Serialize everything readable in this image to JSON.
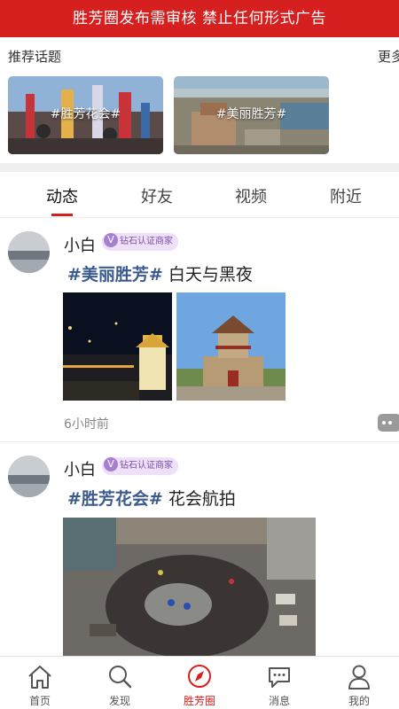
{
  "notice": "胜芳圈发布需审核 禁止任何形式广告",
  "topics": {
    "title": "推荐话题",
    "more": "更多",
    "cards": [
      {
        "label": "#胜芳花会#"
      },
      {
        "label": "#美丽胜芳#"
      }
    ]
  },
  "tabs": [
    "动态",
    "好友",
    "视频",
    "附近"
  ],
  "active_tab": "动态",
  "posts": [
    {
      "username": "小白",
      "badge_icon": "V",
      "badge": "钻石认证商家",
      "hashtag": "#美丽胜芳#",
      "text": " 白天与黑夜",
      "time": "6小时前"
    },
    {
      "username": "小白",
      "badge_icon": "V",
      "badge": "钻石认证商家",
      "hashtag": "#胜芳花会#",
      "text": " 花会航拍"
    }
  ],
  "nav": [
    {
      "label": "首页",
      "icon": "home-icon"
    },
    {
      "label": "发现",
      "icon": "search-icon"
    },
    {
      "label": "胜芳圈",
      "icon": "compass-icon"
    },
    {
      "label": "消息",
      "icon": "chat-bubble-icon"
    },
    {
      "label": "我的",
      "icon": "user-icon"
    }
  ],
  "colors": {
    "brand_red": "#d61f1f",
    "hashtag_blue": "#3b5b8f",
    "badge_purple": "#a77fd0"
  }
}
